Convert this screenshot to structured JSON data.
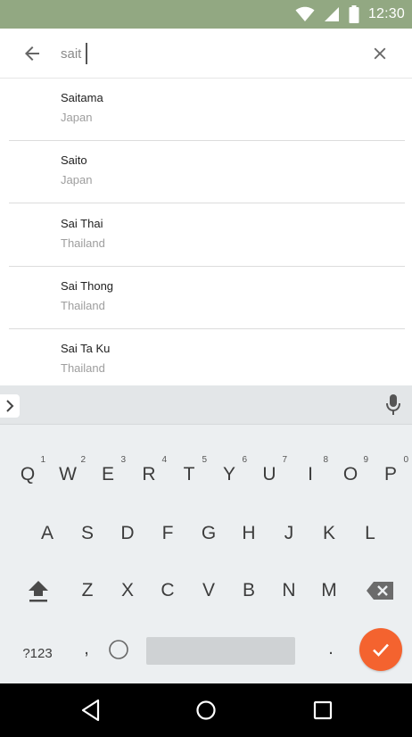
{
  "status_bar": {
    "time": "12:30",
    "bg_color": "#92a882"
  },
  "search": {
    "query": "sait",
    "back_icon": "arrow-left-icon",
    "clear_icon": "close-icon"
  },
  "results": [
    {
      "name": "Saitama",
      "country": "Japan"
    },
    {
      "name": "Saito",
      "country": "Japan"
    },
    {
      "name": "Sai Thai",
      "country": "Thailand"
    },
    {
      "name": "Sai Thong",
      "country": "Thailand"
    },
    {
      "name": "Sai Ta Ku",
      "country": "Thailand"
    }
  ],
  "keyboard": {
    "row1": [
      {
        "key": "Q",
        "hint": "1"
      },
      {
        "key": "W",
        "hint": "2"
      },
      {
        "key": "E",
        "hint": "3"
      },
      {
        "key": "R",
        "hint": "4"
      },
      {
        "key": "T",
        "hint": "5"
      },
      {
        "key": "Y",
        "hint": "6"
      },
      {
        "key": "U",
        "hint": "7"
      },
      {
        "key": "I",
        "hint": "8"
      },
      {
        "key": "O",
        "hint": "9"
      },
      {
        "key": "P",
        "hint": "0"
      }
    ],
    "row2": [
      "A",
      "S",
      "D",
      "F",
      "G",
      "H",
      "J",
      "K",
      "L"
    ],
    "row3": [
      "Z",
      "X",
      "C",
      "V",
      "B",
      "N",
      "M"
    ],
    "symbols_label": "?123",
    "comma_label": ",",
    "period_label": ".",
    "accent_color": "#f4632f"
  }
}
